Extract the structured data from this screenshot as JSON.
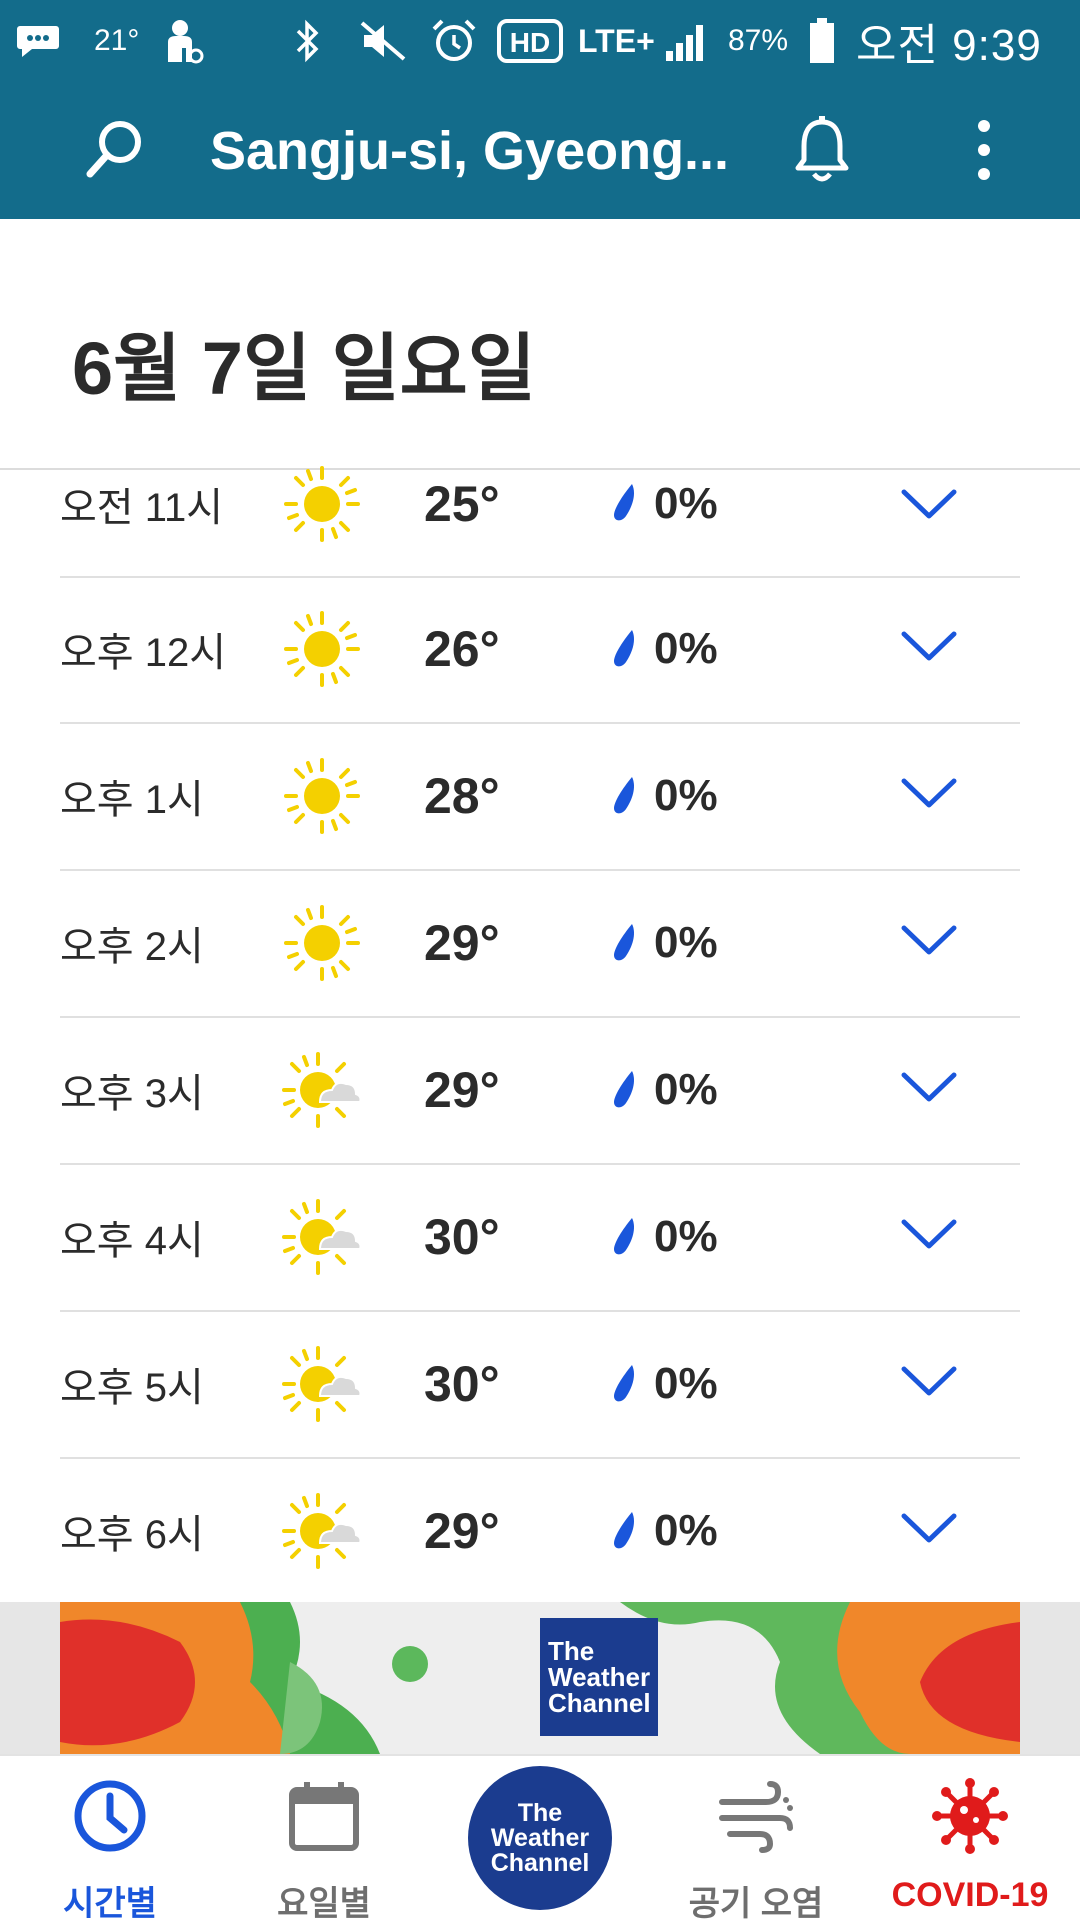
{
  "status_bar": {
    "temperature": "21°",
    "network": "LTE+",
    "battery": "87%",
    "time": "오전 9:39"
  },
  "app_bar": {
    "location": "Sangju-si, Gyeong..."
  },
  "date_header": "6월 7일 일요일",
  "hourly": [
    {
      "time": "오전 11시",
      "icon": "sunny-icon",
      "temp": "25°",
      "precip": "0%"
    },
    {
      "time": "오후 12시",
      "icon": "sunny-icon",
      "temp": "26°",
      "precip": "0%"
    },
    {
      "time": "오후 1시",
      "icon": "sunny-icon",
      "temp": "28°",
      "precip": "0%"
    },
    {
      "time": "오후 2시",
      "icon": "sunny-icon",
      "temp": "29°",
      "precip": "0%"
    },
    {
      "time": "오후 3시",
      "icon": "partly-cloudy-icon",
      "temp": "29°",
      "precip": "0%"
    },
    {
      "time": "오후 4시",
      "icon": "partly-cloudy-icon",
      "temp": "30°",
      "precip": "0%"
    },
    {
      "time": "오후 5시",
      "icon": "partly-cloudy-icon",
      "temp": "30°",
      "precip": "0%"
    },
    {
      "time": "오후 6시",
      "icon": "partly-cloudy-icon",
      "temp": "29°",
      "precip": "0%"
    }
  ],
  "ad": {
    "logo_line1": "The",
    "logo_line2": "Weather",
    "logo_line3": "Channel"
  },
  "bottom_nav": {
    "hourly": "시간별",
    "daily": "요일별",
    "center_line1": "The",
    "center_line2": "Weather",
    "center_line3": "Channel",
    "air_quality": "공기 오염",
    "covid": "COVID-19"
  },
  "colors": {
    "header_bg": "#136c8b",
    "accent_blue": "#1a56db",
    "brand_navy": "#1b3c8f",
    "covid_red": "#e01b1b",
    "sun_yellow": "#f4d000"
  }
}
